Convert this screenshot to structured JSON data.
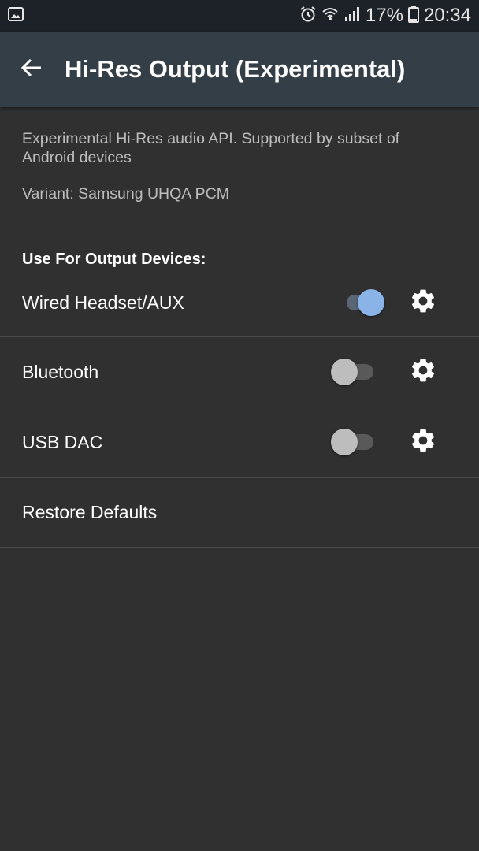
{
  "status_bar": {
    "battery": "17%",
    "time": "20:34",
    "icons": [
      "gallery-icon",
      "alarm-icon",
      "wifi-icon",
      "signal-icon",
      "battery-icon"
    ]
  },
  "app_bar": {
    "title": "Hi-Res Output (Experimental)",
    "back_icon": "arrow-left-icon"
  },
  "content": {
    "description": "Experimental Hi-Res audio API. Supported by subset of Android devices",
    "variant": "Variant: Samsung UHQA PCM",
    "section_title": "Use For Output Devices:",
    "devices": [
      {
        "label": "Wired Headset/AUX",
        "enabled": true
      },
      {
        "label": "Bluetooth",
        "enabled": false
      },
      {
        "label": "USB DAC",
        "enabled": false
      }
    ],
    "restore_label": "Restore Defaults"
  },
  "colors": {
    "background": "#303030",
    "app_bar": "#333e47",
    "status_bar": "#1c2228",
    "toggle_on": "#8ab4e8"
  }
}
